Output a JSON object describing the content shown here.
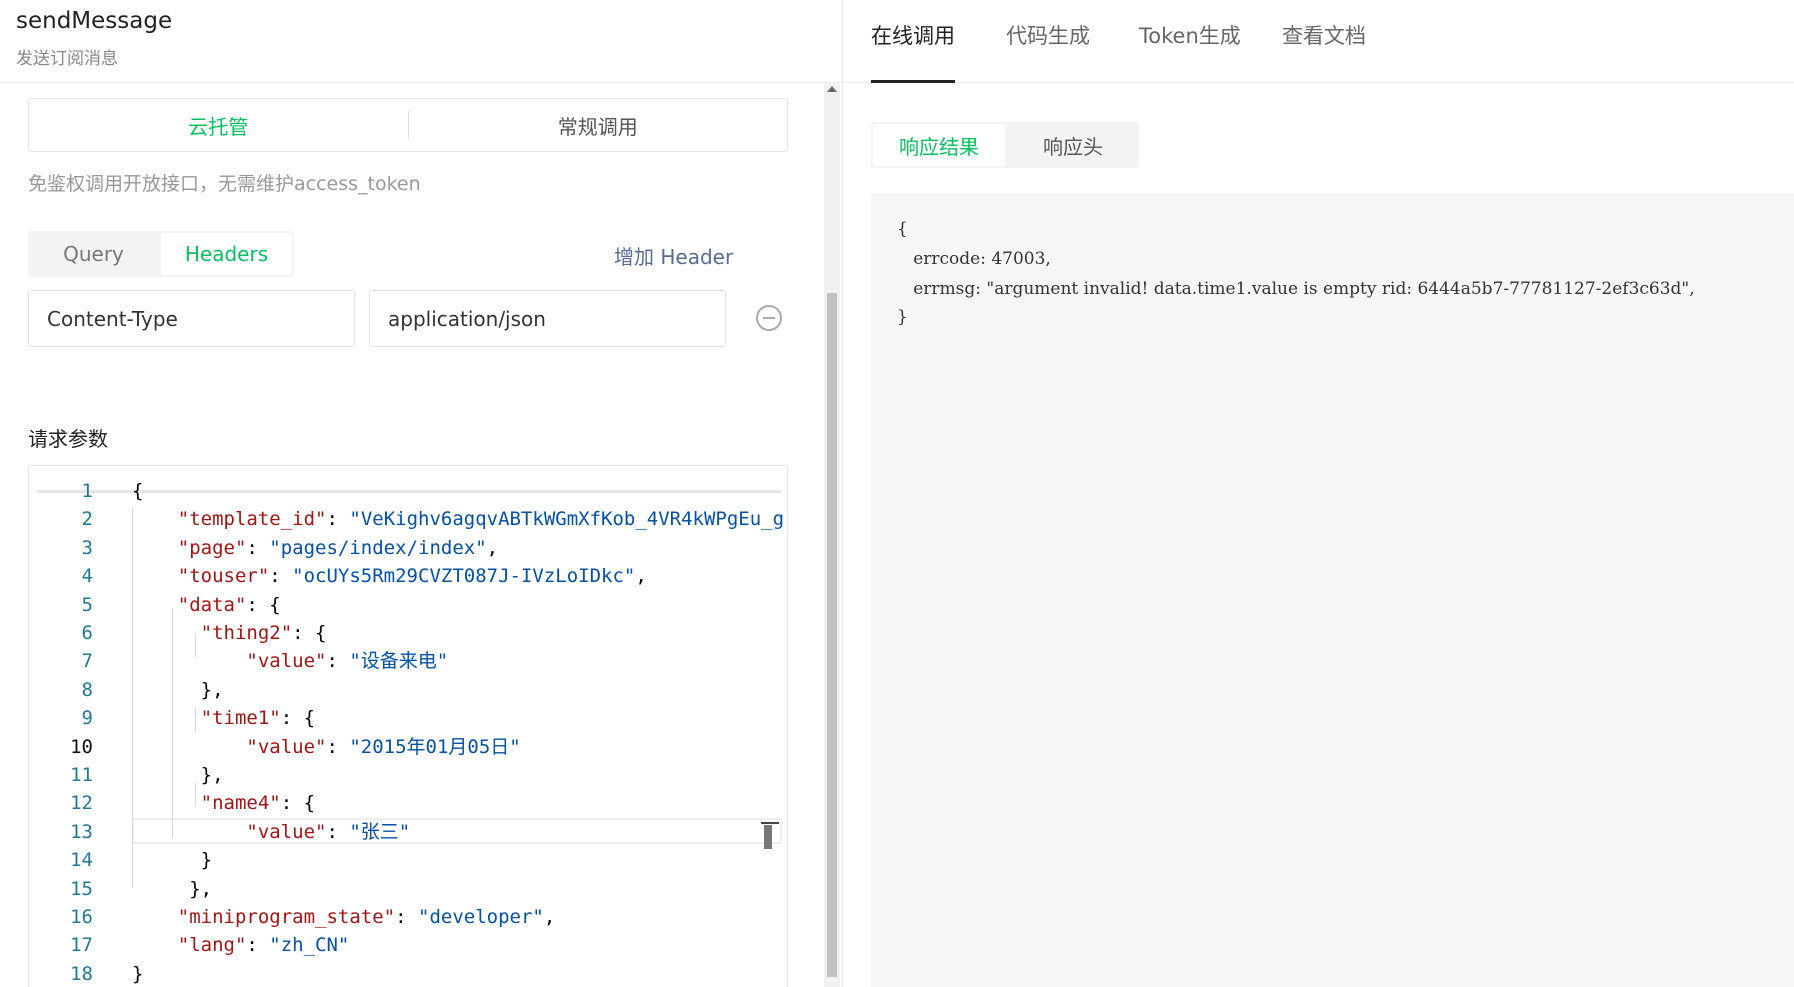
{
  "api": {
    "title": "sendMessage",
    "description": "发送订阅消息"
  },
  "mode": {
    "tabs": [
      {
        "label": "云托管"
      },
      {
        "label": "常规调用"
      }
    ],
    "active": 0,
    "note": "免鉴权调用开放接口，无需维护access_token"
  },
  "params_tabs": [
    {
      "label": "Query"
    },
    {
      "label": "Headers"
    }
  ],
  "add_header_label": "增加 Header",
  "headers": [
    {
      "key": "Content-Type",
      "value": "application/json"
    }
  ],
  "request_section_title": "请求参数",
  "editor": {
    "current_line": 10,
    "lines": [
      {
        "n": "1",
        "parts": [
          [
            "p",
            "{"
          ]
        ]
      },
      {
        "n": "2",
        "parts": [
          [
            "p",
            "    "
          ],
          [
            "k",
            "\"template_id\""
          ],
          [
            "p",
            ": "
          ],
          [
            "s",
            "\"VeKighv6agqvABTkWGmXfKob_4VR4kWPgEu_g"
          ]
        ]
      },
      {
        "n": "3",
        "parts": [
          [
            "p",
            "    "
          ],
          [
            "k",
            "\"page\""
          ],
          [
            "p",
            ": "
          ],
          [
            "s",
            "\"pages/index/index\""
          ],
          [
            "p",
            ","
          ]
        ]
      },
      {
        "n": "4",
        "parts": [
          [
            "p",
            "    "
          ],
          [
            "k",
            "\"touser\""
          ],
          [
            "p",
            ": "
          ],
          [
            "s",
            "\"ocUYs5Rm29CVZT087J-IVzLoIDkc\""
          ],
          [
            "p",
            ","
          ]
        ]
      },
      {
        "n": "5",
        "parts": [
          [
            "p",
            "    "
          ],
          [
            "k",
            "\"data\""
          ],
          [
            "p",
            ": {"
          ]
        ]
      },
      {
        "n": "6",
        "parts": [
          [
            "p",
            "      "
          ],
          [
            "k",
            "\"thing2\""
          ],
          [
            "p",
            ": {"
          ]
        ]
      },
      {
        "n": "7",
        "parts": [
          [
            "p",
            "          "
          ],
          [
            "k",
            "\"value\""
          ],
          [
            "p",
            ": "
          ],
          [
            "s",
            "\"设备来电\""
          ]
        ]
      },
      {
        "n": "8",
        "parts": [
          [
            "p",
            "      },"
          ]
        ]
      },
      {
        "n": "9",
        "parts": [
          [
            "p",
            "      "
          ],
          [
            "k",
            "\"time1\""
          ],
          [
            "p",
            ": {"
          ]
        ]
      },
      {
        "n": "10",
        "parts": [
          [
            "p",
            "          "
          ],
          [
            "k",
            "\"value\""
          ],
          [
            "p",
            ": "
          ],
          [
            "s",
            "\"2015年01月05日\""
          ]
        ]
      },
      {
        "n": "11",
        "parts": [
          [
            "p",
            "      },"
          ]
        ]
      },
      {
        "n": "12",
        "parts": [
          [
            "p",
            "      "
          ],
          [
            "k",
            "\"name4\""
          ],
          [
            "p",
            ": {"
          ]
        ]
      },
      {
        "n": "13",
        "parts": [
          [
            "p",
            "          "
          ],
          [
            "k",
            "\"value\""
          ],
          [
            "p",
            ": "
          ],
          [
            "s",
            "\"张三\""
          ]
        ]
      },
      {
        "n": "14",
        "parts": [
          [
            "p",
            "      }"
          ]
        ]
      },
      {
        "n": "15",
        "parts": [
          [
            "p",
            "     },"
          ]
        ]
      },
      {
        "n": "16",
        "parts": [
          [
            "p",
            "    "
          ],
          [
            "k",
            "\"miniprogram_state\""
          ],
          [
            "p",
            ": "
          ],
          [
            "s",
            "\"developer\""
          ],
          [
            "p",
            ","
          ]
        ]
      },
      {
        "n": "17",
        "parts": [
          [
            "p",
            "    "
          ],
          [
            "k",
            "\"lang\""
          ],
          [
            "p",
            ": "
          ],
          [
            "s",
            "\"zh_CN\""
          ]
        ]
      },
      {
        "n": "18",
        "parts": [
          [
            "p",
            "}"
          ]
        ]
      }
    ]
  },
  "main_tabs": [
    {
      "label": "在线调用"
    },
    {
      "label": "代码生成"
    },
    {
      "label": "Token生成"
    },
    {
      "label": "查看文档"
    }
  ],
  "response_tabs": [
    {
      "label": "响应结果"
    },
    {
      "label": "响应头"
    }
  ],
  "response": {
    "lines": [
      "{",
      "   errcode: 47003,",
      "   errmsg: \"argument invalid! data.time1.value is empty rid: 6444a5b7-77781127-2ef3c63d\",",
      "}"
    ]
  }
}
